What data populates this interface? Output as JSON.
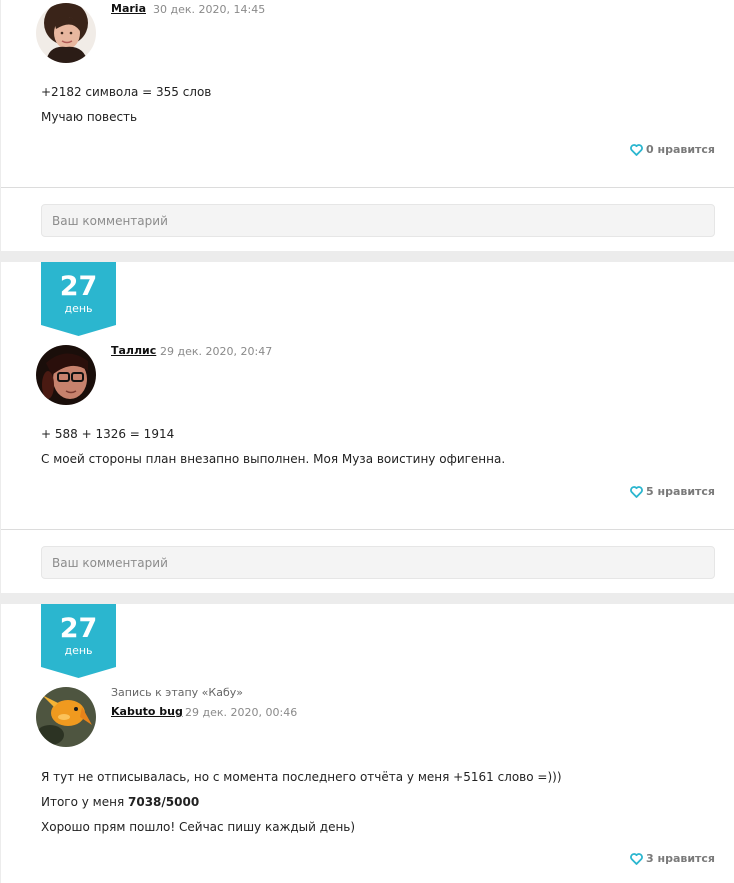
{
  "posts": [
    {
      "author": "Maria",
      "date": "30 дек. 2020, 14:45",
      "lines": [
        "+2182 символа = 355 слов",
        "Мучаю повесть"
      ],
      "likes_label": "0 нравится",
      "comment_placeholder": "Ваш комментарий"
    },
    {
      "day_number": "27",
      "day_label": "день",
      "author": "Таллис",
      "date": "29 дек. 2020, 20:47",
      "lines": [
        "+ 588 + 1326 = 1914",
        "С моей стороны план внезапно выполнен. Моя Муза воистину офигенна."
      ],
      "likes_label": "5 нравится",
      "comment_placeholder": "Ваш комментарий"
    },
    {
      "day_number": "27",
      "day_label": "день",
      "context": "Запись к этапу «Кабу»",
      "author": "Kabuto bug",
      "date": "29 дек. 2020, 00:46",
      "lines": [
        "Я тут не отписывалась, но с момента последнего отчёта у меня +5161 слово =)))",
        "Итого у меня",
        "7038/5000",
        "Хорошо прям пошло! Сейчас пишу каждый день)"
      ],
      "likes_label": "3 нравится"
    }
  ],
  "colors": {
    "accent": "#2bb6cf",
    "like_heart": "#2bb6cf",
    "background": "#ececec"
  },
  "icons": {
    "like": "heart-outline-icon",
    "day_badge": "ribbon-badge"
  }
}
